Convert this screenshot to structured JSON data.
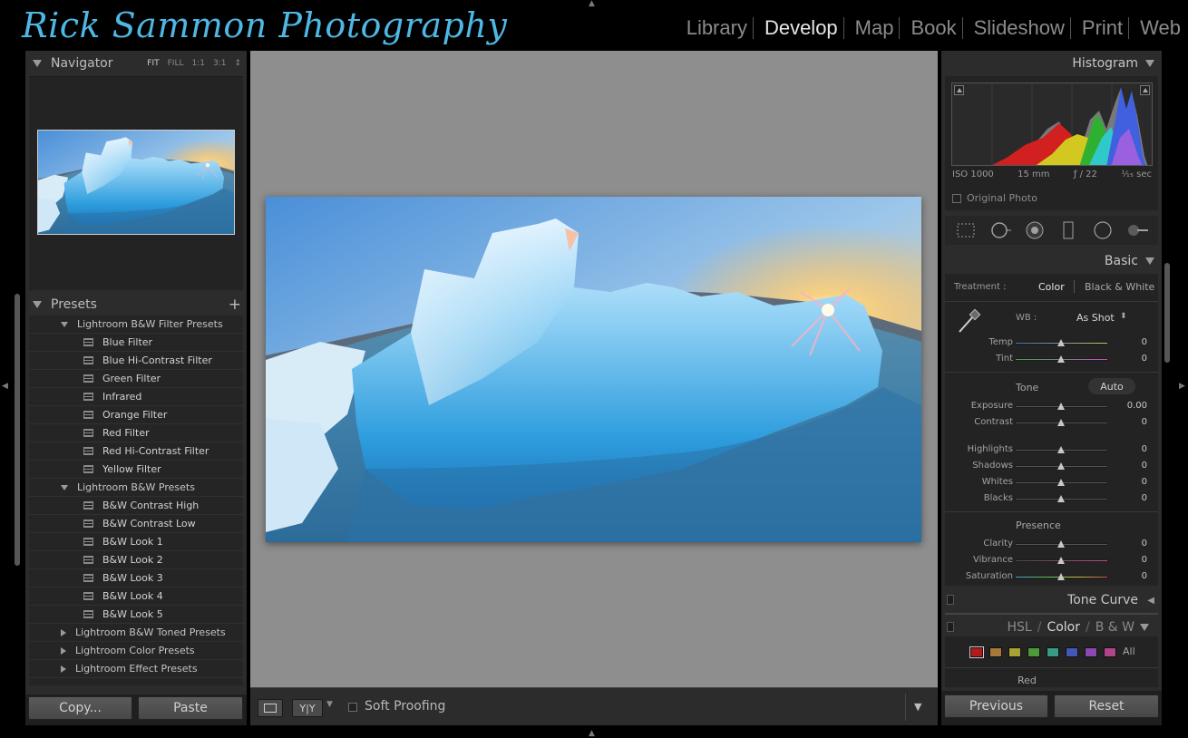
{
  "identity_plate": "Rick Sammon Photography",
  "modules": [
    {
      "label": "Library",
      "active": false
    },
    {
      "label": "Develop",
      "active": true
    },
    {
      "label": "Map",
      "active": false
    },
    {
      "label": "Book",
      "active": false
    },
    {
      "label": "Slideshow",
      "active": false
    },
    {
      "label": "Print",
      "active": false
    },
    {
      "label": "Web",
      "active": false
    }
  ],
  "navigator": {
    "title": "Navigator",
    "zoom": [
      "FIT",
      "FILL",
      "1:1",
      "3:1"
    ],
    "active_zoom": "FIT"
  },
  "presets": {
    "title": "Presets",
    "add_symbol": "+",
    "folders": [
      {
        "label": "Lightroom B&W Filter Presets",
        "expanded": true,
        "items": [
          "Blue Filter",
          "Blue Hi-Contrast Filter",
          "Green Filter",
          "Infrared",
          "Orange Filter",
          "Red Filter",
          "Red Hi-Contrast Filter",
          "Yellow Filter"
        ]
      },
      {
        "label": "Lightroom B&W Presets",
        "expanded": true,
        "items": [
          "B&W Contrast High",
          "B&W Contrast Low",
          "B&W Look 1",
          "B&W Look 2",
          "B&W Look 3",
          "B&W Look 4",
          "B&W Look 5"
        ]
      },
      {
        "label": "Lightroom B&W Toned Presets",
        "expanded": false,
        "items": []
      },
      {
        "label": "Lightroom Color Presets",
        "expanded": false,
        "items": []
      },
      {
        "label": "Lightroom Effect Presets",
        "expanded": false,
        "items": []
      }
    ]
  },
  "left_buttons": {
    "copy": "Copy...",
    "paste": "Paste"
  },
  "toolbar": {
    "soft_proofing": "Soft Proofing",
    "yy": "Y|Y"
  },
  "histogram": {
    "title": "Histogram",
    "iso": "ISO 1000",
    "focal": "15 mm",
    "aperture": "ƒ / 22",
    "shutter": "¹⁄₁₅ sec",
    "original_photo": "Original Photo"
  },
  "basic": {
    "title": "Basic",
    "treatment_label": "Treatment :",
    "treatment_color": "Color",
    "treatment_bw": "Black & White",
    "wb_label": "WB :",
    "wb_value": "As Shot",
    "tone_label": "Tone",
    "auto_label": "Auto",
    "presence_label": "Presence",
    "sliders": {
      "temp": {
        "label": "Temp",
        "value": "0"
      },
      "tint": {
        "label": "Tint",
        "value": "0"
      },
      "exposure": {
        "label": "Exposure",
        "value": "0.00"
      },
      "contrast": {
        "label": "Contrast",
        "value": "0"
      },
      "highlights": {
        "label": "Highlights",
        "value": "0"
      },
      "shadows": {
        "label": "Shadows",
        "value": "0"
      },
      "whites": {
        "label": "Whites",
        "value": "0"
      },
      "blacks": {
        "label": "Blacks",
        "value": "0"
      },
      "clarity": {
        "label": "Clarity",
        "value": "0"
      },
      "vibrance": {
        "label": "Vibrance",
        "value": "0"
      },
      "saturation": {
        "label": "Saturation",
        "value": "0"
      }
    }
  },
  "tone_curve": {
    "title": "Tone Curve"
  },
  "hsl": {
    "hsl": "HSL",
    "color": "Color",
    "bw": "B & W",
    "slash": "/",
    "all": "All",
    "current": "Red",
    "swatches": [
      "#b01b1b",
      "#a8783a",
      "#a8a232",
      "#4e9a3a",
      "#3a9a86",
      "#4258b8",
      "#8a48b0",
      "#b0468a"
    ]
  },
  "right_buttons": {
    "previous": "Previous",
    "reset": "Reset"
  }
}
